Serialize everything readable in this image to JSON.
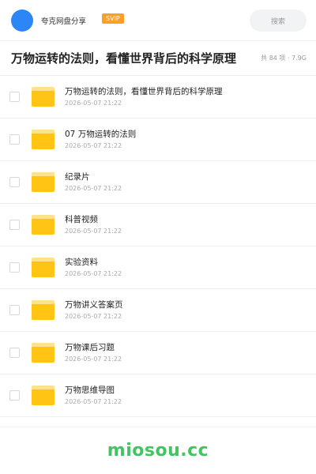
{
  "header": {
    "user_name": "夸克网盘分享",
    "badge": "SVIP",
    "search_placeholder": "搜索"
  },
  "title_row": {
    "title": "万物运转的法则，看懂世界背后的科学原理",
    "meta": "共 84 项 · 7.9G"
  },
  "files": [
    {
      "name": "万物运转的法则，看懂世界背后的科学原理",
      "date": "2026-05-07 21:22"
    },
    {
      "name": "07 万物运转的法则",
      "date": "2026-05-07 21:22"
    },
    {
      "name": "纪录片",
      "date": "2026-05-07 21:22"
    },
    {
      "name": "科普视频",
      "date": "2026-05-07 21:22"
    },
    {
      "name": "实验资料",
      "date": "2026-05-07 21:22"
    },
    {
      "name": "万物讲义答案页",
      "date": "2026-05-07 21:22"
    },
    {
      "name": "万物课后习题",
      "date": "2026-05-07 21:22"
    },
    {
      "name": "万物思维导图",
      "date": "2026-05-07 21:22"
    }
  ],
  "footer": {
    "watermark": "miosou.cc"
  },
  "colors": {
    "avatar": "#2d86f5",
    "badge": "#ff9f28",
    "folder": "#ffc414",
    "watermark": "#43c461"
  }
}
